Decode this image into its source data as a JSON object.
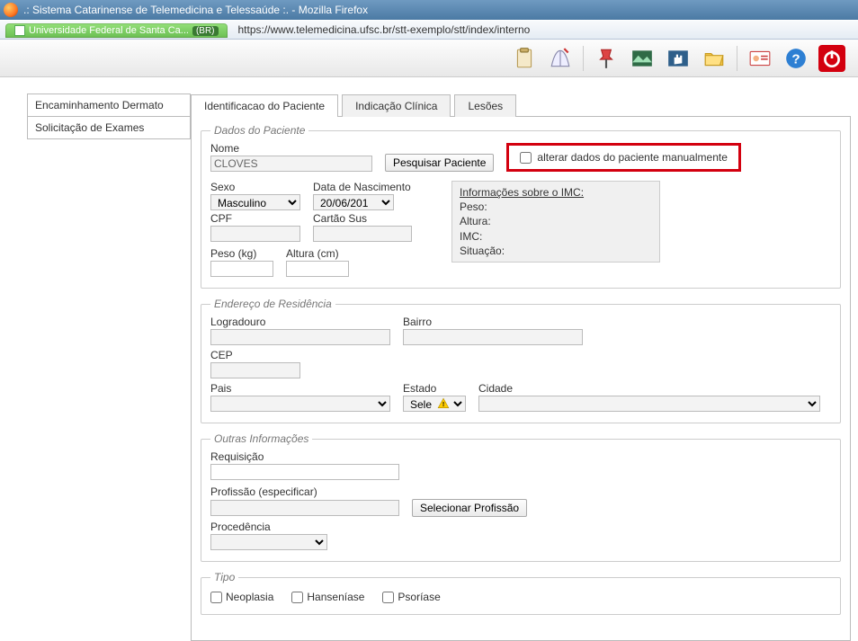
{
  "browser": {
    "window_title": ".: Sistema Catarinense de Telemedicina e Telessaúde :. - Mozilla Firefox",
    "tab_label": "Universidade Federal de Santa Ca...",
    "locale_badge": "(BR)",
    "url": "https://www.telemedicina.ufsc.br/stt-exemplo/stt/index/interno"
  },
  "leftnav": {
    "items": [
      "Encaminhamento Dermato",
      "Solicitação de Exames"
    ]
  },
  "tabs": {
    "items": [
      "Identificacao do Paciente",
      "Indicação Clínica",
      "Lesões"
    ],
    "active_index": 0
  },
  "fieldsets": {
    "dados": {
      "legend": "Dados do Paciente",
      "nome_label": "Nome",
      "nome_value": "CLOVES",
      "btn_pesquisar": "Pesquisar Paciente",
      "alterar_label": "alterar dados do paciente manualmente",
      "sexo_label": "Sexo",
      "sexo_value": "Masculino",
      "dn_label": "Data de Nascimento",
      "dn_value": "20/06/201",
      "cpf_label": "CPF",
      "cartao_label": "Cartão Sus",
      "peso_label": "Peso (kg)",
      "altura_label": "Altura (cm)",
      "imc": {
        "header": "Informações sobre o IMC:",
        "peso": "Peso:",
        "altura": "Altura:",
        "imc": "IMC:",
        "situacao": "Situação:"
      }
    },
    "endereco": {
      "legend": "Endereço de Residência",
      "logradouro_label": "Logradouro",
      "bairro_label": "Bairro",
      "cep_label": "CEP",
      "pais_label": "Pais",
      "estado_label": "Estado",
      "estado_value": "Sele",
      "cidade_label": "Cidade"
    },
    "outras": {
      "legend": "Outras Informações",
      "requisicao_label": "Requisição",
      "profissao_label": "Profissão (especificar)",
      "btn_sel_prof": "Selecionar Profissão",
      "procedencia_label": "Procedência"
    },
    "tipo": {
      "legend": "Tipo",
      "opts": [
        "Neoplasia",
        "Hanseníase",
        "Psoríase"
      ]
    }
  }
}
